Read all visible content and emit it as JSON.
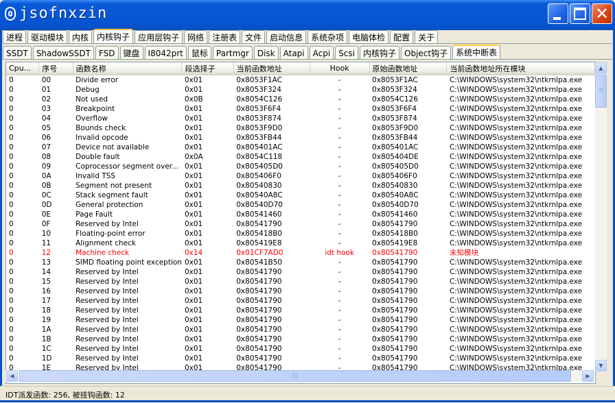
{
  "window": {
    "title": "jsofnxzin",
    "minimize_icon": "minimize-icon",
    "maximize_icon": "maximize-icon",
    "close_icon": "close-icon",
    "close_glyph": "✕"
  },
  "main_tabs": [
    "进程",
    "驱动模块",
    "内核",
    "内核钩子",
    "应用层钩子",
    "网络",
    "注册表",
    "文件",
    "启动信息",
    "系统杂项",
    "电脑体检",
    "配置",
    "关于"
  ],
  "main_tabs_active": 3,
  "sub_tabs": [
    "SSDT",
    "ShadowSSDT",
    "FSD",
    "键盘",
    "I8042prt",
    "鼠标",
    "Partmgr",
    "Disk",
    "Atapi",
    "Acpi",
    "Scsi",
    "内核钩子",
    "Object钩子",
    "系统中断表"
  ],
  "sub_tabs_active": 13,
  "table": {
    "columns": [
      "Cpu...",
      "序号",
      "函数名称",
      "段选择子",
      "当前函数地址",
      "Hook",
      "原始函数地址",
      "当前函数地址所在模块"
    ],
    "rows": [
      [
        "0",
        "00",
        "Divide error",
        "0x01",
        "0x8053F1AC",
        "-",
        "0x8053F1AC",
        "C:\\WINDOWS\\system32\\ntkrnlpa.exe"
      ],
      [
        "0",
        "01",
        "Debug",
        "0x01",
        "0x8053F324",
        "-",
        "0x8053F324",
        "C:\\WINDOWS\\system32\\ntkrnlpa.exe"
      ],
      [
        "0",
        "02",
        "Not used",
        "0x0B",
        "0x8054C126",
        "-",
        "0x8054C126",
        "C:\\WINDOWS\\system32\\ntkrnlpa.exe"
      ],
      [
        "0",
        "03",
        "Breakpoint",
        "0x01",
        "0x8053F6F4",
        "-",
        "0x8053F6F4",
        "C:\\WINDOWS\\system32\\ntkrnlpa.exe"
      ],
      [
        "0",
        "04",
        "Overflow",
        "0x01",
        "0x8053F874",
        "-",
        "0x8053F874",
        "C:\\WINDOWS\\system32\\ntkrnlpa.exe"
      ],
      [
        "0",
        "05",
        "Bounds check",
        "0x01",
        "0x8053F9D0",
        "-",
        "0x8053F9D0",
        "C:\\WINDOWS\\system32\\ntkrnlpa.exe"
      ],
      [
        "0",
        "06",
        "Invalid opcode",
        "0x01",
        "0x8053FB44",
        "-",
        "0x8053FB44",
        "C:\\WINDOWS\\system32\\ntkrnlpa.exe"
      ],
      [
        "0",
        "07",
        "Device not available",
        "0x01",
        "0x805401AC",
        "-",
        "0x805401AC",
        "C:\\WINDOWS\\system32\\ntkrnlpa.exe"
      ],
      [
        "0",
        "08",
        "Double fault",
        "0x0A",
        "0x8054C118",
        "-",
        "0x805404DE",
        "C:\\WINDOWS\\system32\\ntkrnlpa.exe"
      ],
      [
        "0",
        "09",
        "Coprocessor segment over...",
        "0x01",
        "0x805405D0",
        "-",
        "0x805405D0",
        "C:\\WINDOWS\\system32\\ntkrnlpa.exe"
      ],
      [
        "0",
        "0A",
        "Invalid TSS",
        "0x01",
        "0x805406F0",
        "-",
        "0x805406F0",
        "C:\\WINDOWS\\system32\\ntkrnlpa.exe"
      ],
      [
        "0",
        "0B",
        "Segment not present",
        "0x01",
        "0x80540830",
        "-",
        "0x80540830",
        "C:\\WINDOWS\\system32\\ntkrnlpa.exe"
      ],
      [
        "0",
        "0C",
        "Stack segment fault",
        "0x01",
        "0x80540A8C",
        "-",
        "0x80540A8C",
        "C:\\WINDOWS\\system32\\ntkrnlpa.exe"
      ],
      [
        "0",
        "0D",
        "General protection",
        "0x01",
        "0x80540D70",
        "-",
        "0x80540D70",
        "C:\\WINDOWS\\system32\\ntkrnlpa.exe"
      ],
      [
        "0",
        "0E",
        "Page Fault",
        "0x01",
        "0x80541460",
        "-",
        "0x80541460",
        "C:\\WINDOWS\\system32\\ntkrnlpa.exe"
      ],
      [
        "0",
        "0F",
        "Reserved by Intel",
        "0x01",
        "0x80541790",
        "-",
        "0x80541790",
        "C:\\WINDOWS\\system32\\ntkrnlpa.exe"
      ],
      [
        "0",
        "10",
        "Floating-point error",
        "0x01",
        "0x805418B0",
        "-",
        "0x805418B0",
        "C:\\WINDOWS\\system32\\ntkrnlpa.exe"
      ],
      [
        "0",
        "11",
        "Alignment check",
        "0x01",
        "0x805419E8",
        "-",
        "0x805419E8",
        "C:\\WINDOWS\\system32\\ntkrnlpa.exe"
      ],
      [
        "0",
        "12",
        "Machine check",
        "0x14",
        "0x01CF7AD0",
        "idt hook",
        "0x80541790",
        "未知模块"
      ],
      [
        "0",
        "13",
        "SIMD floating point exception",
        "0x01",
        "0x80541B50",
        "-",
        "0x80541790",
        "C:\\WINDOWS\\system32\\ntkrnlpa.exe"
      ],
      [
        "0",
        "14",
        "Reserved by Intel",
        "0x01",
        "0x80541790",
        "-",
        "0x80541790",
        "C:\\WINDOWS\\system32\\ntkrnlpa.exe"
      ],
      [
        "0",
        "15",
        "Reserved by Intel",
        "0x01",
        "0x80541790",
        "-",
        "0x80541790",
        "C:\\WINDOWS\\system32\\ntkrnlpa.exe"
      ],
      [
        "0",
        "16",
        "Reserved by Intel",
        "0x01",
        "0x80541790",
        "-",
        "0x80541790",
        "C:\\WINDOWS\\system32\\ntkrnlpa.exe"
      ],
      [
        "0",
        "17",
        "Reserved by Intel",
        "0x01",
        "0x80541790",
        "-",
        "0x80541790",
        "C:\\WINDOWS\\system32\\ntkrnlpa.exe"
      ],
      [
        "0",
        "18",
        "Reserved by Intel",
        "0x01",
        "0x80541790",
        "-",
        "0x80541790",
        "C:\\WINDOWS\\system32\\ntkrnlpa.exe"
      ],
      [
        "0",
        "19",
        "Reserved by Intel",
        "0x01",
        "0x80541790",
        "-",
        "0x80541790",
        "C:\\WINDOWS\\system32\\ntkrnlpa.exe"
      ],
      [
        "0",
        "1A",
        "Reserved by Intel",
        "0x01",
        "0x80541790",
        "-",
        "0x80541790",
        "C:\\WINDOWS\\system32\\ntkrnlpa.exe"
      ],
      [
        "0",
        "1B",
        "Reserved by Intel",
        "0x01",
        "0x80541790",
        "-",
        "0x80541790",
        "C:\\WINDOWS\\system32\\ntkrnlpa.exe"
      ],
      [
        "0",
        "1C",
        "Reserved by Intel",
        "0x01",
        "0x80541790",
        "-",
        "0x80541790",
        "C:\\WINDOWS\\system32\\ntkrnlpa.exe"
      ],
      [
        "0",
        "1D",
        "Reserved by Intel",
        "0x01",
        "0x80541790",
        "-",
        "0x80541790",
        "C:\\WINDOWS\\system32\\ntkrnlpa.exe"
      ],
      [
        "0",
        "1E",
        "Reserved by Intel",
        "0x01",
        "0x80541790",
        "-",
        "0x80541790",
        "C:\\WINDOWS\\system32\\ntkrnlpa.exe"
      ]
    ],
    "hooked_row_index": 18,
    "hook_color": "#ff0000"
  },
  "scrollbars": {
    "up_icon": "scroll-up-icon",
    "down_icon": "scroll-down-icon",
    "left_icon": "scroll-left-icon",
    "right_icon": "scroll-right-icon",
    "up_glyph": "▲",
    "down_glyph": "▼",
    "left_glyph": "◀",
    "right_glyph": "▶",
    "grip_glyph": "≡",
    "hgrip_glyph": "|||"
  },
  "status": {
    "text": "IDT派发函数: 256, 被挂钩函数: 12"
  }
}
